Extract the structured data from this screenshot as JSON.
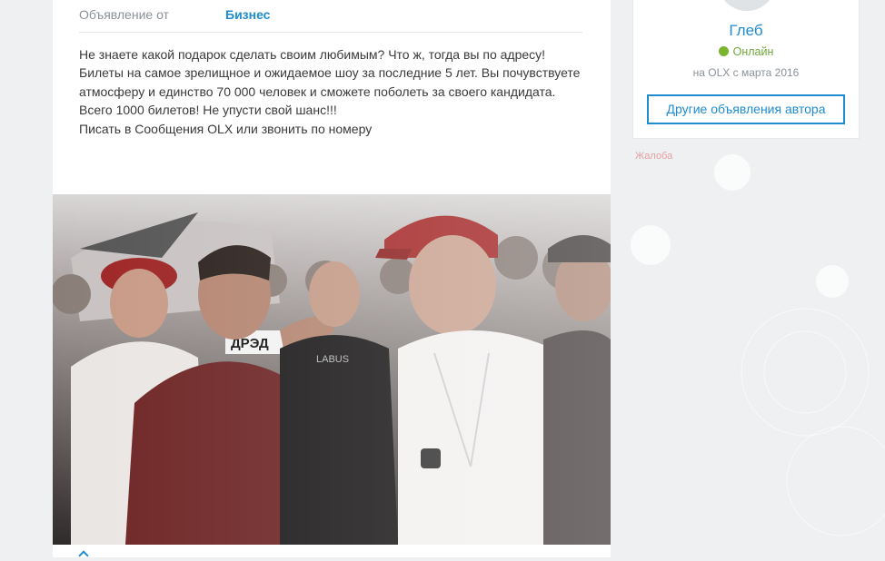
{
  "listing": {
    "offer_from_label": "Объявление от",
    "offer_from_value": "Бизнес",
    "description_lines": [
      "Не знаете какой подарок сделать своим любимым? Что ж, тогда вы по адресу!",
      "Билеты на самое зрелищное и ожидаемое шоу за последние 5 лет. Вы почувствуете",
      "атмосферу и единство 70 000 человек и сможете поболеть за своего кандидата.",
      "Всего 1000 билетов! Не упусти свой шанс!!!",
      "Писать в Сообщения OLX или звонить по номеру"
    ],
    "photo": {
      "logo_text": "ДРЭД",
      "shirt_text": "LABUS"
    }
  },
  "seller": {
    "name": "Глеб",
    "status": "Онлайн",
    "status_color": "#7ab52f",
    "member_since": "на OLX с марта 2016",
    "other_ads_button": "Другие объявления автора"
  },
  "complaint_link": "Жалоба",
  "colors": {
    "accent": "#1f8bd0",
    "page_bg": "#eef0f2"
  }
}
